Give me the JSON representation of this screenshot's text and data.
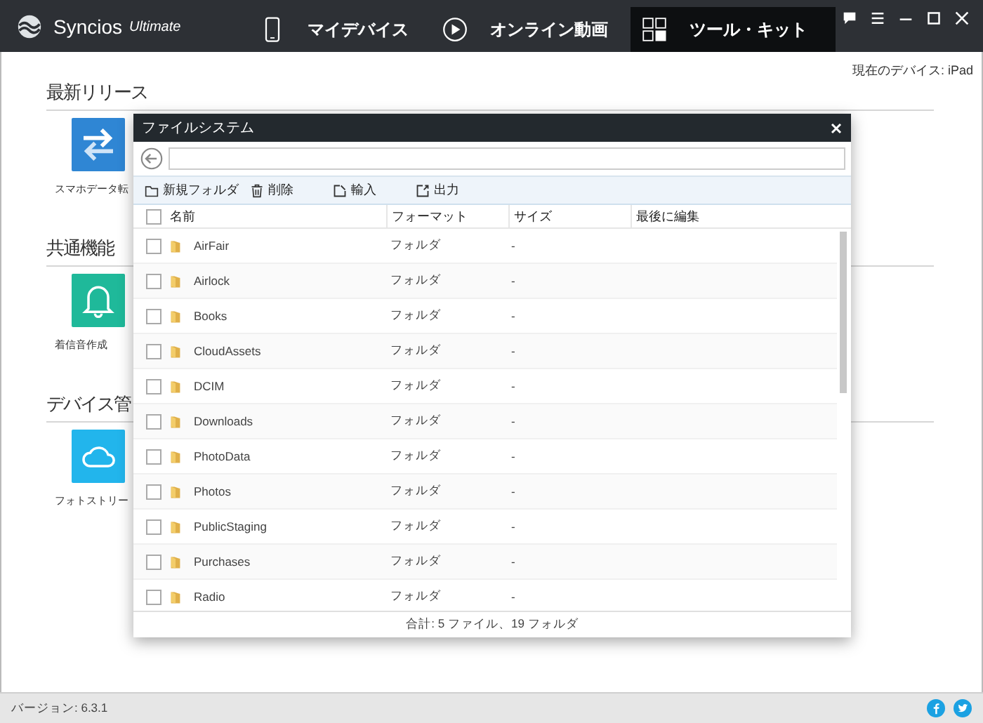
{
  "app": {
    "name": "Syncios",
    "edition": "Ultimate"
  },
  "tabs": [
    {
      "label": "マイデバイス",
      "kind": "phone",
      "selected": false
    },
    {
      "label": "オンライン動画",
      "kind": "play",
      "selected": false
    },
    {
      "label": "ツール・キット",
      "kind": "grid",
      "selected": true
    }
  ],
  "current_device": "現在のデバイス: iPad",
  "sections": [
    {
      "title": "最新リリース",
      "tools": [
        {
          "label": "スマホデータ転",
          "kind": "transfer",
          "color": "#2f86d4"
        }
      ]
    },
    {
      "title": "共通機能",
      "tools": [
        {
          "label": "着信音作成",
          "kind": "bell",
          "color": "#1fb99a"
        }
      ]
    },
    {
      "title": "デバイス管",
      "tools": [
        {
          "label": "フォトストリー",
          "kind": "cloud",
          "color": "#22b5ec"
        }
      ]
    }
  ],
  "dialog": {
    "title": "ファイルシステム",
    "toolbar": [
      {
        "label": "新規フォルダ",
        "kind": "folder"
      },
      {
        "label": "削除",
        "kind": "trash"
      },
      {
        "label": "輸入",
        "kind": "import"
      },
      {
        "label": "出力",
        "kind": "export"
      }
    ],
    "columns": [
      "名前",
      "フォーマット",
      "サイズ",
      "最後に編集"
    ],
    "header_checked": false,
    "rows": [
      {
        "name": "AirFair",
        "format": "フォルダ",
        "size": "-",
        "checked": false
      },
      {
        "name": "Airlock",
        "format": "フォルダ",
        "size": "-",
        "checked": false
      },
      {
        "name": "Books",
        "format": "フォルダ",
        "size": "-",
        "checked": false
      },
      {
        "name": "CloudAssets",
        "format": "フォルダ",
        "size": "-",
        "checked": false
      },
      {
        "name": "DCIM",
        "format": "フォルダ",
        "size": "-",
        "checked": false
      },
      {
        "name": "Downloads",
        "format": "フォルダ",
        "size": "-",
        "checked": false
      },
      {
        "name": "PhotoData",
        "format": "フォルダ",
        "size": "-",
        "checked": false
      },
      {
        "name": "Photos",
        "format": "フォルダ",
        "size": "-",
        "checked": false
      },
      {
        "name": "PublicStaging",
        "format": "フォルダ",
        "size": "-",
        "checked": false
      },
      {
        "name": "Purchases",
        "format": "フォルダ",
        "size": "-",
        "checked": false
      },
      {
        "name": "Radio",
        "format": "フォルダ",
        "size": "-",
        "checked": false
      }
    ],
    "footer": "合計: 5 ファイル、19 フォルダ"
  },
  "version": "バージョン: 6.3.1"
}
